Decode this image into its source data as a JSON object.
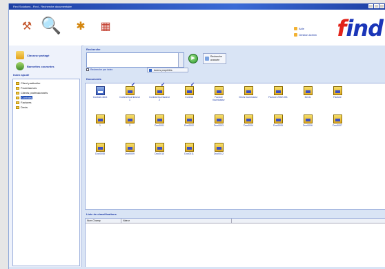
{
  "window": {
    "title": "Find Solutions - Find - Recherche documentaire"
  },
  "toolbar": {
    "buttons": [
      {
        "name": "tools-icon",
        "glyph": "⚒"
      },
      {
        "name": "search-icon",
        "glyph": "🔍"
      },
      {
        "name": "puzzle-icon",
        "glyph": "✱"
      },
      {
        "name": "calendar-icon",
        "glyph": "▦"
      }
    ],
    "links": [
      "Aide",
      "Gestion Admin"
    ],
    "brand_prefix": "f",
    "brand_rest": "ind"
  },
  "sidebar": {
    "actions": [
      "Classeur partagé",
      "Bannettes courantes"
    ],
    "tree_title": "Index ajouté",
    "tree_items": [
      {
        "label": "Client particulier",
        "selected": false
      },
      {
        "label": "Fournisseurs",
        "selected": false
      },
      {
        "label": "Clients professionnels",
        "selected": false
      },
      {
        "label": "Contrats",
        "selected": true
      },
      {
        "label": "Factures",
        "selected": false
      },
      {
        "label": "Devis",
        "selected": false
      }
    ]
  },
  "search": {
    "label": "Recherche",
    "button_go": "▶",
    "advanced_label": "Recherche avancée",
    "checkbox_label": "Recherche par index",
    "options_button": "Autres propriétés"
  },
  "documents": {
    "label": "Documents",
    "items": [
      {
        "label": "Contrat client",
        "kind": "pad"
      },
      {
        "label": "Contrat fournisseur 1",
        "kind": "chk2"
      },
      {
        "label": "Contrat fournisseur 2",
        "kind": "chk2"
      },
      {
        "label": "Contrat",
        "kind": "chk2"
      },
      {
        "label": "Facture fournisseur",
        "kind": "doc"
      },
      {
        "label": "Devis fournisseur",
        "kind": "doc"
      },
      {
        "label": "Facture 2002-001",
        "kind": "doc"
      },
      {
        "label": "Devis",
        "kind": "doc"
      },
      {
        "label": "Facture",
        "kind": "doc"
      },
      {
        "label": "1",
        "kind": "doc"
      },
      {
        "label": "2",
        "kind": "doc"
      },
      {
        "label": "Doc0001",
        "kind": "doc"
      },
      {
        "label": "Doc0002",
        "kind": "doc"
      },
      {
        "label": "Doc0003",
        "kind": "doc"
      },
      {
        "label": "Doc0004",
        "kind": "doc"
      },
      {
        "label": "Doc0005",
        "kind": "doc"
      },
      {
        "label": "Doc0006",
        "kind": "doc"
      },
      {
        "label": "Doc0007",
        "kind": "doc"
      },
      {
        "label": "Doc0008",
        "kind": "doc"
      },
      {
        "label": "Doc0009",
        "kind": "doc"
      },
      {
        "label": "Doc0010",
        "kind": "doc"
      },
      {
        "label": "Doc0011",
        "kind": "doc"
      },
      {
        "label": "Doc0012",
        "kind": "doc"
      }
    ]
  },
  "properties": {
    "label": "Liste de classifications",
    "columns": [
      "Nom Champ",
      "Valeur",
      ""
    ]
  }
}
